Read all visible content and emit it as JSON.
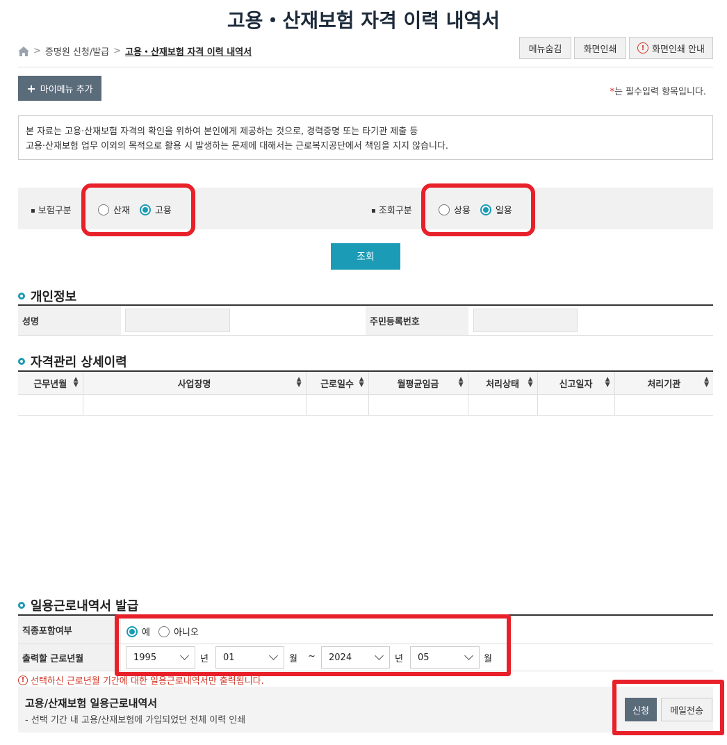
{
  "page": {
    "title": "고용・산재보험 자격 이력 내역서",
    "breadcrumb": {
      "item1": "증명원 신청/발급",
      "current": "고용・산재보험 자격 이력 내역서"
    },
    "top_buttons": {
      "hide_menu": "메뉴숨김",
      "print": "화면인쇄",
      "print_guide": "화면인쇄 안내"
    },
    "mymenu_label": "마이메뉴 추가",
    "required_note": "는 필수입력 항목입니다.",
    "notice": {
      "line1": "본 자료는 고용·산재보험 자격의 확인을 위하여 본인에게 제공하는 것으로, 경력증명 또는 타기관 제출 등",
      "line2": "고용·산재보험 업무 이외의 목적으로 활용 시 발생하는 문제에 대해서는 근로복지공단에서 책임을 지지 않습니다."
    }
  },
  "filter": {
    "insurance": {
      "label": "보험구분",
      "options": [
        "산재",
        "고용"
      ],
      "selected": "고용"
    },
    "inquiry": {
      "label": "조회구분",
      "options": [
        "상용",
        "일용"
      ],
      "selected": "일용"
    },
    "search_button": "조회"
  },
  "personal": {
    "heading": "개인정보",
    "name_label": "성명",
    "rrn_label": "주민등록번호"
  },
  "history": {
    "heading": "자격관리 상세이력",
    "columns": [
      "근무년월",
      "사업장명",
      "근로일수",
      "월평균임금",
      "처리상태",
      "신고일자",
      "처리기관"
    ],
    "rows": []
  },
  "daily": {
    "heading": "일용근로내역서 발급",
    "job_label": "직종포함여부",
    "job_options": [
      "예",
      "아니오"
    ],
    "job_selected": "예",
    "period_label": "출력할 근로년월",
    "from_year": "1995",
    "from_month": "01",
    "to_year": "2024",
    "to_month": "05",
    "year_unit": "년",
    "month_unit": "월",
    "tilde": "~",
    "warning": "선택하신 근로년월 기간에 대한 일용근로내역서만 출력됩니다.",
    "doc_title": "고용/산재보험 일용근로내역서",
    "doc_desc": "- 선택 기간 내 고용/산재보험에 가입되었던 전체 이력 인쇄",
    "apply_button": "신청",
    "mail_button": "메일전송"
  },
  "colors": {
    "accent": "#1b9bb5",
    "highlight": "#e8202a",
    "dark_button": "#5a6b7a"
  }
}
